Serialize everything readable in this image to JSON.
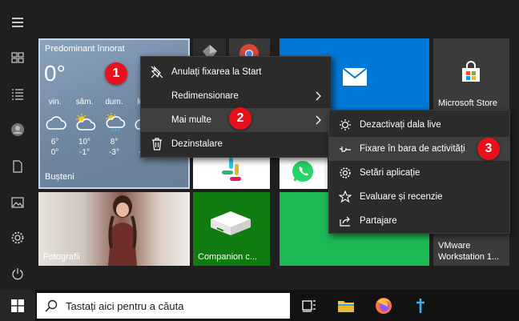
{
  "weather": {
    "condition": "Predominant înnorat",
    "temp": "0°",
    "city": "Bușteni",
    "days": [
      {
        "name": "vin.",
        "hi": "6°",
        "lo": "0°",
        "icon": "partly-cloudy-icon"
      },
      {
        "name": "sâm.",
        "hi": "10°",
        "lo": "-1°",
        "icon": "partly-sunny-icon"
      },
      {
        "name": "dum.",
        "hi": "8°",
        "lo": "-3°",
        "icon": "sun-rain-icon"
      },
      {
        "name": "lun.",
        "hi": "5°",
        "lo": "-5°",
        "icon": "cloudy-icon"
      }
    ]
  },
  "tiles": {
    "store": "Microsoft Store",
    "photos": "Fotografii",
    "companion": "Companion c...",
    "vmware_line1": "VMware",
    "vmware_line2": "Workstation 1..."
  },
  "menu1": {
    "items": [
      "Anulați fixarea la Start",
      "Redimensionare",
      "Mai multe",
      "Dezinstalare"
    ]
  },
  "menu2": {
    "items": [
      "Dezactivați dala live",
      "Fixare în bara de activități",
      "Setări aplicație",
      "Evaluare și recenzie",
      "Partajare"
    ]
  },
  "badges": [
    "1",
    "2",
    "3"
  ],
  "taskbar": {
    "search_placeholder": "Tastați aici pentru a căuta"
  },
  "colors": {
    "accent_blue": "#0078d7",
    "spotify_green": "#1db954",
    "companion_green": "#107c10",
    "badge_red": "#e8111b"
  }
}
